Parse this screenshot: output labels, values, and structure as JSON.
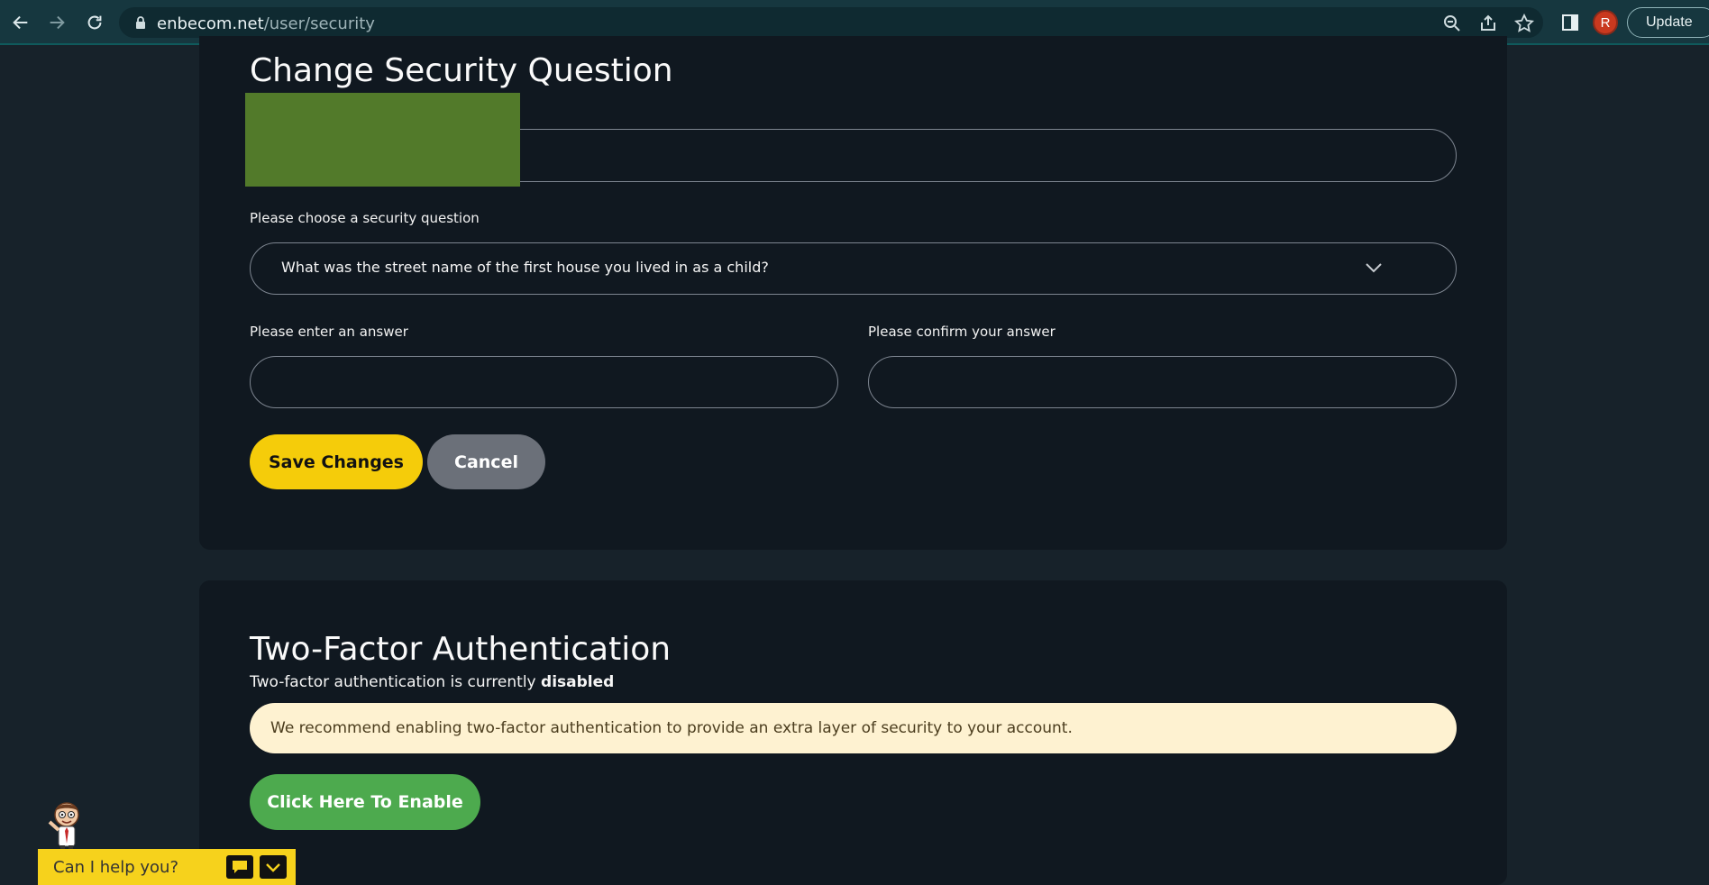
{
  "browser": {
    "url_domain": "enbecom.net",
    "url_path": "/user/security",
    "avatar_letter": "R",
    "update_label": "Update"
  },
  "security_question": {
    "title": "Change Security Question",
    "question_label": "Please choose a security question",
    "selected_question": "What was the street name of the first house you lived in as a child?",
    "answer_label": "Please enter an answer",
    "answer_value": "",
    "confirm_label": "Please confirm your answer",
    "confirm_value": "",
    "save_label": "Save Changes",
    "cancel_label": "Cancel"
  },
  "two_factor": {
    "title": "Two-Factor Authentication",
    "status_prefix": "Two-factor authentication is currently ",
    "status_value": "disabled",
    "recommendation": "We recommend enabling two-factor authentication to provide an extra layer of security to your account.",
    "enable_label": "Click Here To Enable"
  },
  "chat": {
    "prompt": "Can I help you?"
  },
  "colors": {
    "accent_yellow": "#f5cc0a",
    "enable_green": "#4daa4e",
    "card_bg": "#101820",
    "page_bg": "#17222a"
  }
}
